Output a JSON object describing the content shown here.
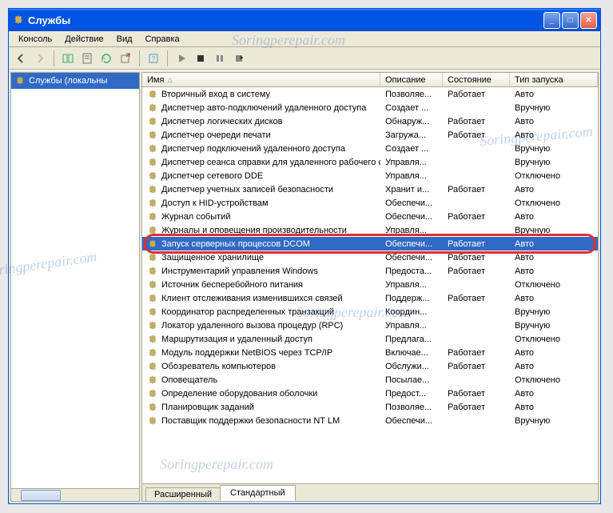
{
  "window": {
    "title": "Службы"
  },
  "menu": {
    "items": [
      "Консоль",
      "Действие",
      "Вид",
      "Справка"
    ]
  },
  "tree": {
    "root": "Службы (локальны"
  },
  "columns": {
    "name": "Имя",
    "desc": "Описание",
    "state": "Состояние",
    "start": "Тип запуска"
  },
  "tabs": {
    "ext": "Расширенный",
    "std": "Стандартный"
  },
  "services": [
    {
      "name": "Вторичный вход в систему",
      "desc": "Позволяе...",
      "state": "Работает",
      "start": "Авто"
    },
    {
      "name": "Диспетчер авто-подключений удаленного доступа",
      "desc": "Создает ...",
      "state": "",
      "start": "Вручную"
    },
    {
      "name": "Диспетчер логических дисков",
      "desc": "Обнаруж...",
      "state": "Работает",
      "start": "Авто"
    },
    {
      "name": "Диспетчер очереди печати",
      "desc": "Загружа...",
      "state": "Работает",
      "start": "Авто"
    },
    {
      "name": "Диспетчер подключений удаленного доступа",
      "desc": "Создает ...",
      "state": "",
      "start": "Вручную"
    },
    {
      "name": "Диспетчер сеанса справки для удаленного рабочего ст...",
      "desc": "Управля...",
      "state": "",
      "start": "Вручную"
    },
    {
      "name": "Диспетчер сетевого DDE",
      "desc": "Управля...",
      "state": "",
      "start": "Отключено"
    },
    {
      "name": "Диспетчер учетных записей безопасности",
      "desc": "Хранит и...",
      "state": "Работает",
      "start": "Авто"
    },
    {
      "name": "Доступ к HID-устройствам",
      "desc": "Обеспечи...",
      "state": "",
      "start": "Отключено"
    },
    {
      "name": "Журнал событий",
      "desc": "Обеспечи...",
      "state": "Работает",
      "start": "Авто"
    },
    {
      "name": "Журналы и оповещения производительности",
      "desc": "Управля...",
      "state": "",
      "start": "Вручную"
    },
    {
      "name": "Запуск серверных процессов DCOM",
      "desc": "Обеспечи...",
      "state": "Работает",
      "start": "Авто",
      "selected": true,
      "highlighted": true
    },
    {
      "name": "Защищенное хранилище",
      "desc": "Обеспечи...",
      "state": "Работает",
      "start": "Авто"
    },
    {
      "name": "Инструментарий управления Windows",
      "desc": "Предоста...",
      "state": "Работает",
      "start": "Авто"
    },
    {
      "name": "Источник бесперебойного питания",
      "desc": "Управля...",
      "state": "",
      "start": "Отключено"
    },
    {
      "name": "Клиент отслеживания изменившихся связей",
      "desc": "Поддерж...",
      "state": "Работает",
      "start": "Авто"
    },
    {
      "name": "Координатор распределенных транзакций",
      "desc": "Координ...",
      "state": "",
      "start": "Вручную"
    },
    {
      "name": "Локатор удаленного вызова процедур (RPC)",
      "desc": "Управля...",
      "state": "",
      "start": "Вручную"
    },
    {
      "name": "Маршрутизация и удаленный доступ",
      "desc": "Предлага...",
      "state": "",
      "start": "Отключено"
    },
    {
      "name": "Модуль поддержки NetBIOS через TCP/IP",
      "desc": "Включае...",
      "state": "Работает",
      "start": "Авто"
    },
    {
      "name": "Обозреватель компьютеров",
      "desc": "Обслужи...",
      "state": "Работает",
      "start": "Авто"
    },
    {
      "name": "Оповещатель",
      "desc": "Посылае...",
      "state": "",
      "start": "Отключено"
    },
    {
      "name": "Определение оборудования оболочки",
      "desc": "Предост...",
      "state": "Работает",
      "start": "Авто"
    },
    {
      "name": "Планировщик заданий",
      "desc": "Позволяе...",
      "state": "Работает",
      "start": "Авто"
    },
    {
      "name": "Поставщик поддержки безопасности NT LM",
      "desc": "Обеспечи...",
      "state": "",
      "start": "Вручную"
    }
  ],
  "watermarks": [
    "Soringperepair.com",
    "Soringperepair.com",
    "Soringperepair.com",
    "Soringperepair.com",
    "Soringperepair.com"
  ]
}
